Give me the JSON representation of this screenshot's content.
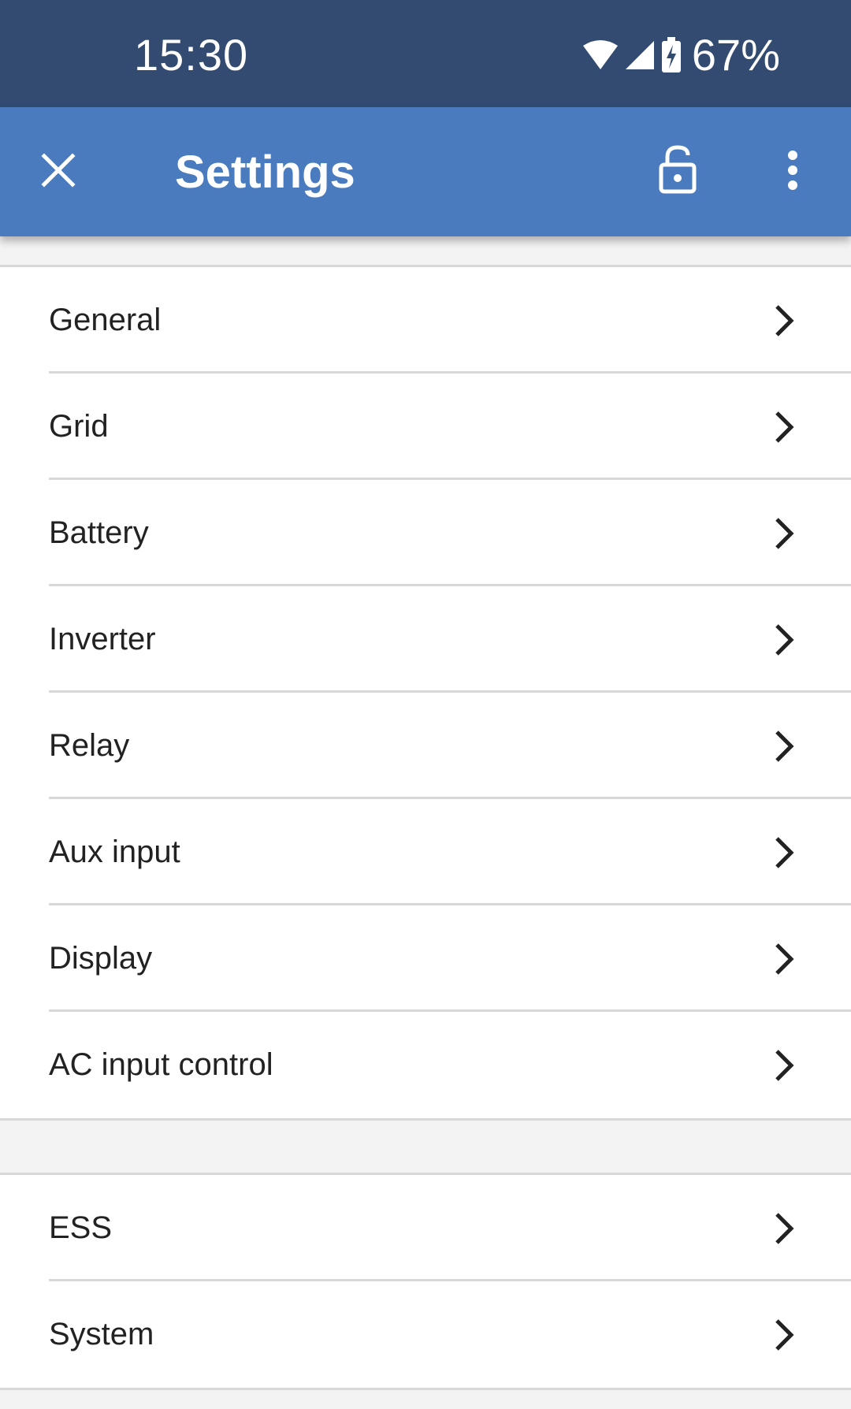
{
  "status_bar": {
    "time": "15:30",
    "battery_percent": "67%",
    "icons": [
      "wifi-icon",
      "cellular-signal-icon",
      "battery-charging-icon"
    ]
  },
  "app_bar": {
    "title": "Settings",
    "icons": [
      "close-icon",
      "lock-icon",
      "more-vert-icon"
    ]
  },
  "menu_groups": [
    {
      "items": [
        {
          "label": "General"
        },
        {
          "label": "Grid"
        },
        {
          "label": "Battery"
        },
        {
          "label": "Inverter"
        },
        {
          "label": "Relay"
        },
        {
          "label": "Aux input"
        },
        {
          "label": "Display"
        },
        {
          "label": "AC input control"
        }
      ]
    },
    {
      "items": [
        {
          "label": "ESS"
        },
        {
          "label": "System"
        }
      ]
    }
  ],
  "colors": {
    "status_bar": "#334b70",
    "app_bar": "#4a7bbf",
    "background": "#f3f3f3",
    "list_background": "#ffffff",
    "divider": "#d8d8d8",
    "text": "#222222"
  }
}
